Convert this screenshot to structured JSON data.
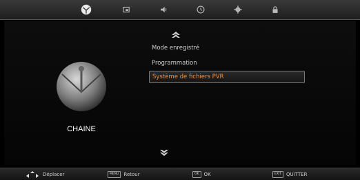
{
  "tabs": [
    {
      "icon": "satellite-dish-icon",
      "active": true
    },
    {
      "icon": "picture-icon",
      "active": false
    },
    {
      "icon": "sound-icon",
      "active": false
    },
    {
      "icon": "clock-icon",
      "active": false
    },
    {
      "icon": "gear-icon",
      "active": false
    },
    {
      "icon": "lock-icon",
      "active": false
    }
  ],
  "section": {
    "label": "CHAINE",
    "icon": "satellite-dish-icon"
  },
  "menu": {
    "items": [
      {
        "label": "Mode enregistré",
        "selected": false
      },
      {
        "label": "Programmation",
        "selected": false
      },
      {
        "label": "Système de fichiers PVR",
        "selected": true
      }
    ]
  },
  "help": {
    "move_label": "Déplacer",
    "back_key": "MENU",
    "back_label": "Retour",
    "ok_key": "OK",
    "ok_label": "OK",
    "exit_key": "EXIT",
    "exit_label": "QUITTER"
  },
  "colors": {
    "selected_text": "#ff8a28",
    "background": "#000000"
  }
}
